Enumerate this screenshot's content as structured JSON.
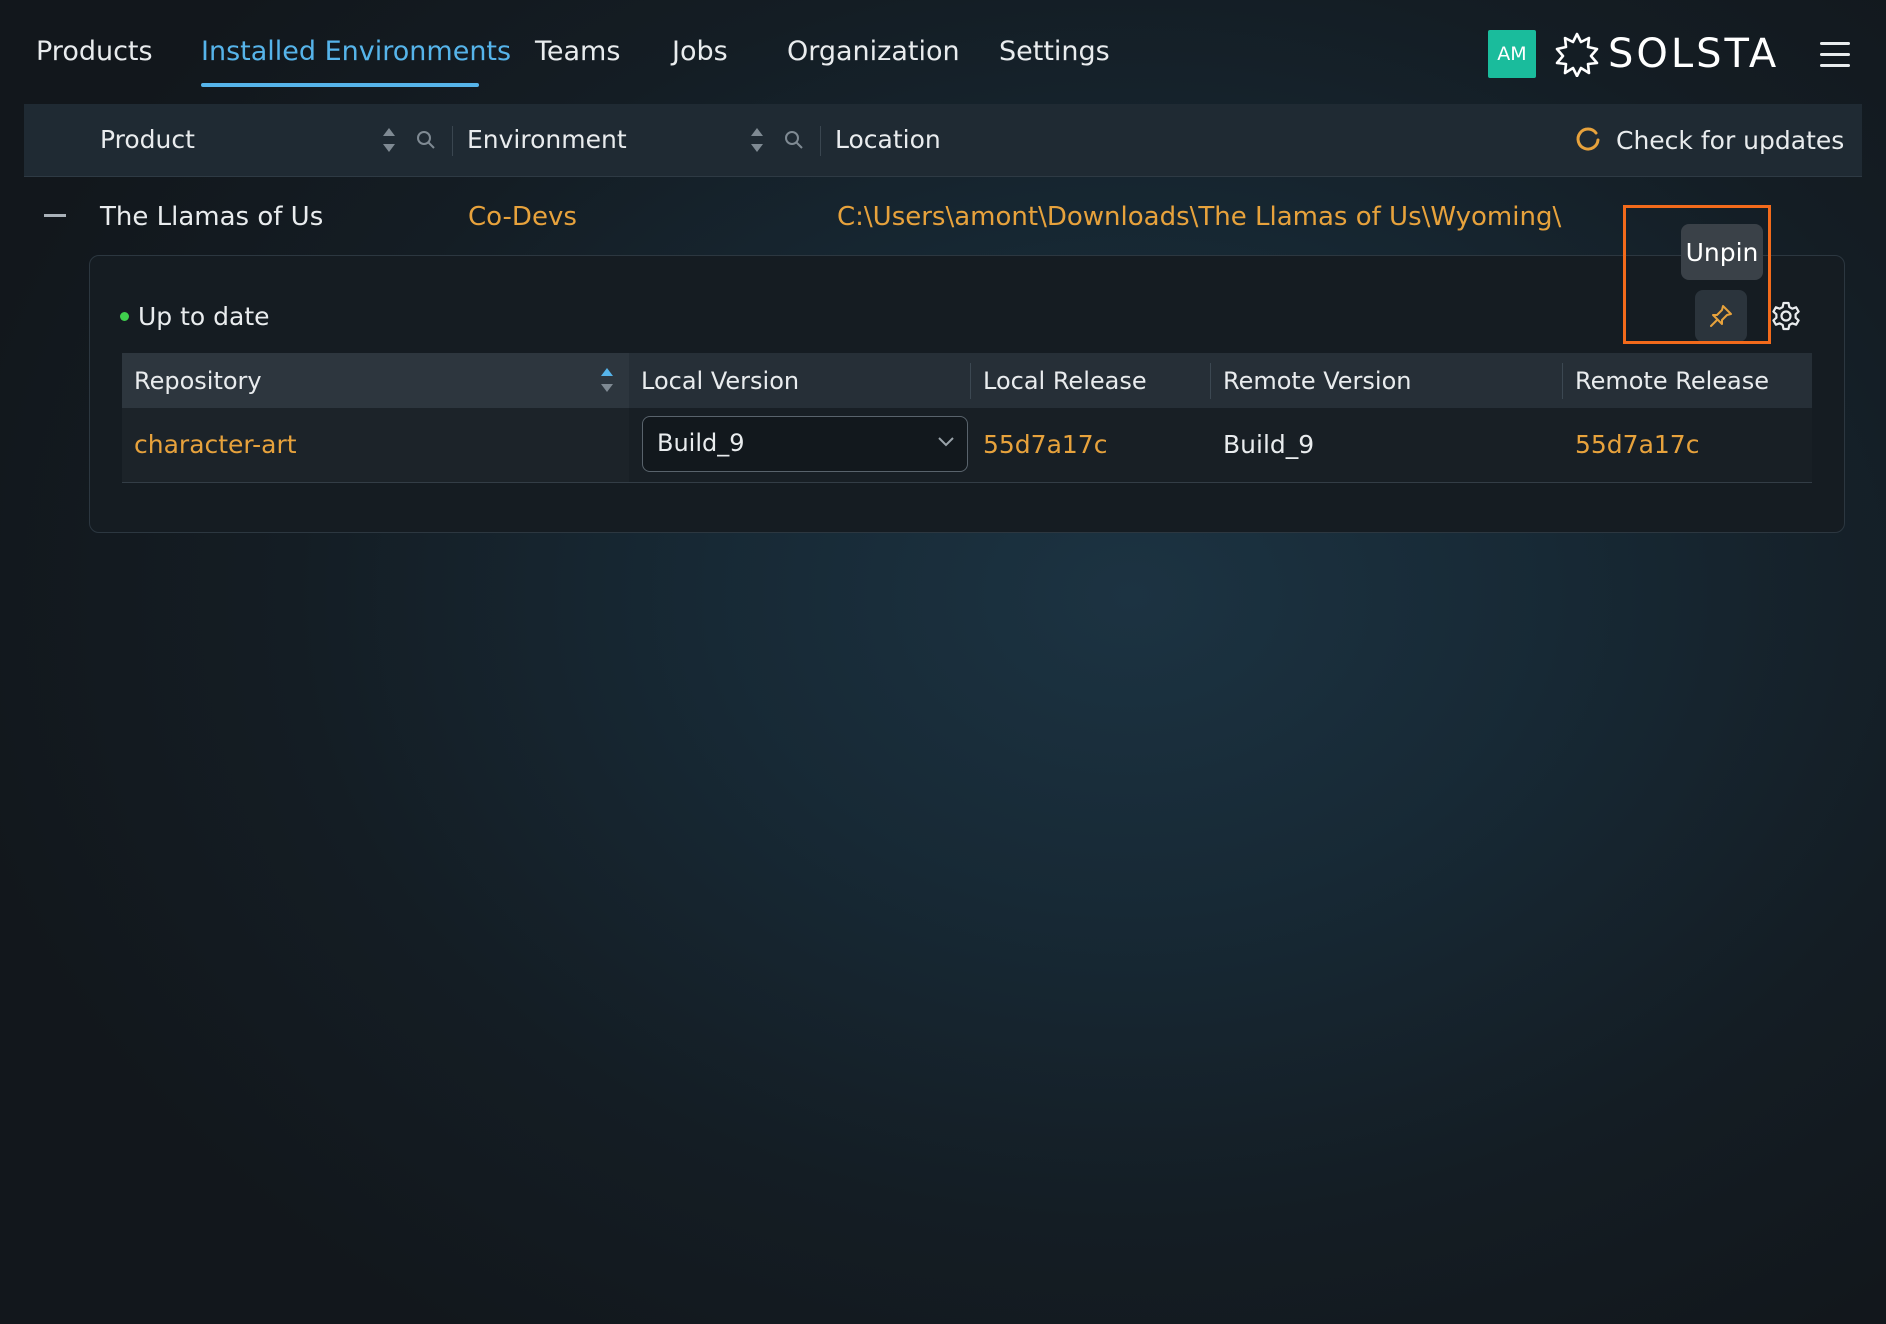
{
  "nav": {
    "tabs": [
      {
        "label": "Products"
      },
      {
        "label": "Installed Environments"
      },
      {
        "label": "Teams"
      },
      {
        "label": "Jobs"
      },
      {
        "label": "Organization"
      },
      {
        "label": "Settings"
      }
    ],
    "active_tab": "Installed Environments",
    "avatar_initials": "AM",
    "logo_text": "SOLSTA",
    "accent_color": "#56b4ea"
  },
  "table": {
    "columns": {
      "product": "Product",
      "environment": "Environment",
      "location": "Location"
    },
    "check_updates_label": "Check for updates",
    "rows": [
      {
        "product": "The Llamas of Us",
        "environment": "Co-Devs",
        "location": "C:\\Users\\amont\\Downloads\\The Llamas of Us\\Wyoming\\"
      }
    ]
  },
  "detail": {
    "status": "Up to date",
    "status_color": "#3fcf4d",
    "tooltip": "Unpin",
    "columns": {
      "repository": "Repository",
      "local_version": "Local Version",
      "local_release": "Local Release",
      "remote_version": "Remote Version",
      "remote_release": "Remote Release"
    },
    "rows": [
      {
        "repository": "character-art",
        "local_version": "Build_9",
        "local_release": "55d7a17c",
        "remote_version": "Build_9",
        "remote_release": "55d7a17c"
      }
    ]
  },
  "colors": {
    "link_orange": "#e7a23c",
    "highlight": "#f26a1b"
  }
}
